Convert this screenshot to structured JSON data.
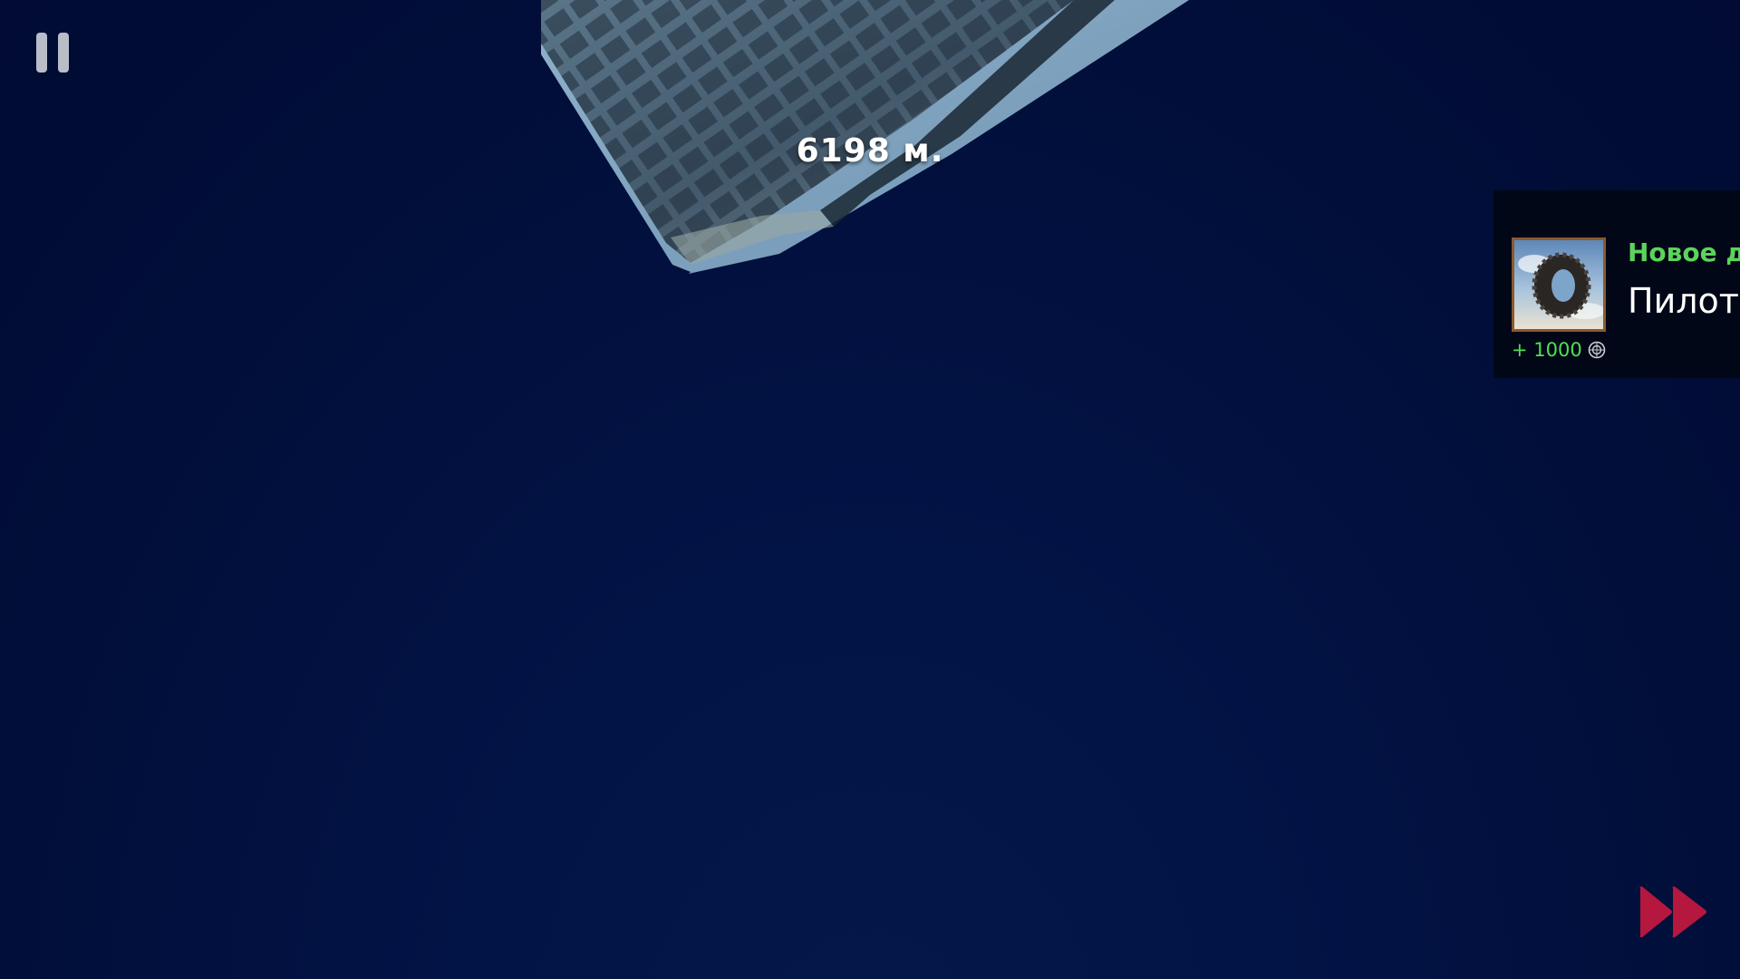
{
  "hud": {
    "distance": "6198 м.",
    "pause_icon": "pause-icon",
    "fast_forward_icon": "fast-forward-icon"
  },
  "achievement": {
    "title": "Новое д",
    "name": "Пилот",
    "reward": "+ 1000",
    "reward_icon": "coin-icon",
    "thumbnail_icon": "tire-icon"
  },
  "colors": {
    "background": "#010e38",
    "achievement_title": "#5cd35c",
    "reward": "#4fe04f",
    "fast_forward": "#b5173f",
    "pause": "#b8bdc8"
  }
}
